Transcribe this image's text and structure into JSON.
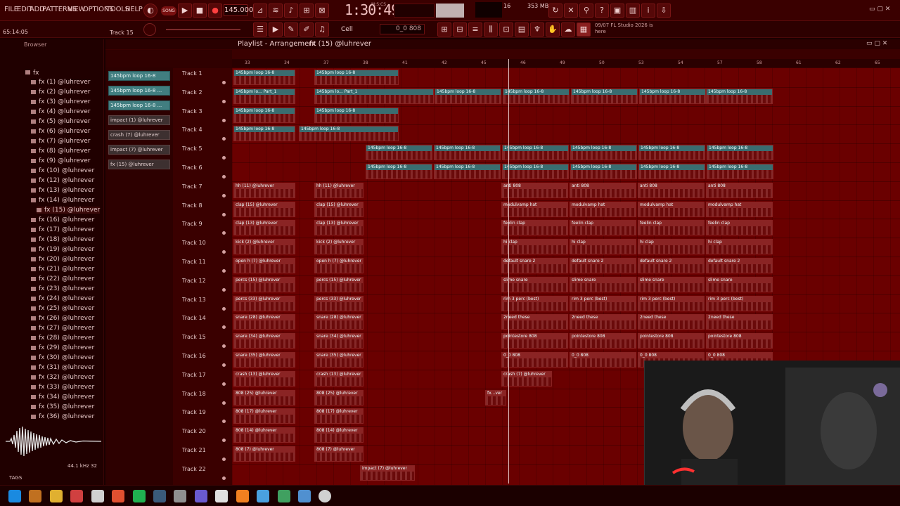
{
  "menu": [
    "FILE",
    "EDIT",
    "ADD",
    "PATTERNS",
    "VIEW",
    "OPTIONS",
    "TOOLS",
    "HELP"
  ],
  "transport": {
    "mode": "SONG",
    "tempo": "145.000",
    "time": "1:30:49",
    "time_sub": "M:S:CS"
  },
  "cpu": {
    "a": "16",
    "b": "353 MB",
    "c": "5"
  },
  "hint": {
    "time": "65:14:05",
    "track": "Track 15"
  },
  "snap": {
    "label": "Cell",
    "pattern": "0_0 808"
  },
  "news": {
    "line1": "09/07 FL Studio 2026 is",
    "line2": "here"
  },
  "browser": {
    "title": "Browser",
    "root": "fx",
    "items": [
      "fx (1) @luhrever",
      "fx (2) @luhrever",
      "fx (3) @luhrever",
      "fx (4) @luhrever",
      "fx (5) @luhrever",
      "fx (6) @luhrever",
      "fx (7) @luhrever",
      "fx (8) @luhrever",
      "fx (9) @luhrever",
      "fx (10) @luhrever",
      "fx (12) @luhrever",
      "fx (13) @luhrever",
      "fx (14) @luhrever",
      "fx (15) @luhrever",
      "fx (16) @luhrever",
      "fx (17) @luhrever",
      "fx (18) @luhrever",
      "fx (19) @luhrever",
      "fx (20) @luhrever",
      "fx (21) @luhrever",
      "fx (22) @luhrever",
      "fx (23) @luhrever",
      "fx (24) @luhrever",
      "fx (25) @luhrever",
      "fx (26) @luhrever",
      "fx (27) @luhrever",
      "fx (28) @luhrever",
      "fx (29) @luhrever",
      "fx (30) @luhrever",
      "fx (31) @luhrever",
      "fx (32) @luhrever",
      "fx (33) @luhrever",
      "fx (34) @luhrever",
      "fx (35) @luhrever",
      "fx (36) @luhrever"
    ],
    "sample_rate": "44.1 kHz 32",
    "tags": "TAGS"
  },
  "playlist": {
    "title": "Playlist - Arrangement",
    "breadcrumb": "fx (15) @luhrever",
    "patterns": [
      "145bpm loop 16-8",
      "145bpm loop 16-8 ...",
      "145bpm loop 16-8 ...",
      "impact (1) @luhrever",
      "crash (7) @luhrever",
      "impact (7) @luhrever",
      "fx (15) @luhrever"
    ],
    "ruler": [
      "33",
      "34",
      "37",
      "38",
      "41",
      "42",
      "45",
      "46",
      "49",
      "50",
      "53",
      "54",
      "57",
      "58",
      "61",
      "62",
      "65"
    ],
    "tracks": [
      "Track 1",
      "Track 2",
      "Track 3",
      "Track 4",
      "Track 5",
      "Track 6",
      "Track 7",
      "Track 8",
      "Track 9",
      "Track 10",
      "Track 11",
      "Track 12",
      "Track 13",
      "Track 14",
      "Track 15",
      "Track 16",
      "Track 17",
      "Track 18",
      "Track 19",
      "Track 20",
      "Track 21",
      "Track 22"
    ]
  },
  "clips": {
    "loop": "145bpm loop 16-8",
    "loop_p1": "145bpm lo... Part_1",
    "hh": "hh (11) @luhrever",
    "clap15": "clap (15) @luhrever",
    "clap13": "clap (13) @luhrever",
    "kick2": "kick (2) @luhrever",
    "openh7": "open h (7) @luhrever",
    "percs15": "percs (15) @luhrever",
    "percs33": "percs (33) @luhrever",
    "snare28": "snare (28) @luhrever",
    "snare34": "snare (34) @luhrever",
    "snare35": "snare (35) @luhrever",
    "crash13": "crash (13) @luhrever",
    "b808_25": "808 (25) @luhrever",
    "b808_17": "808 (17) @luhrever",
    "b808_14": "808 (14) @luhrever",
    "b808_7": "808 (7) @luhrever",
    "anti808": "anti 808",
    "modul": "modulvamp hat",
    "feelin": "feelin clap",
    "hiclap": "hi clap",
    "defsnare": "default snare 2",
    "slime": "slime snare",
    "rim": "rim 3 perc (best)",
    "zneed": "2need these",
    "pointe": "pointestore 808",
    "z808": "0_0 808",
    "crash7": "crash (7) @luhrever",
    "fxver": "fx...ver",
    "impact7": "impact (7) @luhrever"
  }
}
